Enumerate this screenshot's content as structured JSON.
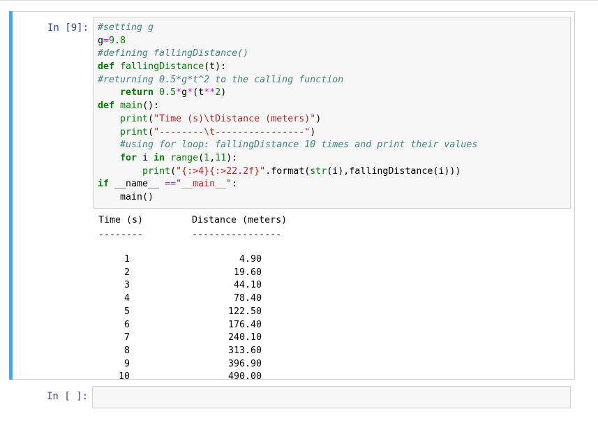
{
  "cells": [
    {
      "prompt": "In [9]:",
      "code_lines": [
        [
          {
            "c": "cm",
            "t": "#setting g"
          }
        ],
        [
          {
            "c": "",
            "t": "g"
          },
          {
            "c": "op",
            "t": "="
          },
          {
            "c": "num",
            "t": "9.8"
          }
        ],
        [
          {
            "c": "cm",
            "t": "#defining fallingDistance()"
          }
        ],
        [
          {
            "c": "kw",
            "t": "def"
          },
          {
            "c": "",
            "t": " "
          },
          {
            "c": "nm",
            "t": "fallingDistance"
          },
          {
            "c": "",
            "t": "(t):"
          }
        ],
        [
          {
            "c": "cm",
            "t": "#returning 0.5*g*t^2 to the calling function"
          }
        ],
        [
          {
            "c": "",
            "t": "    "
          },
          {
            "c": "kw",
            "t": "return"
          },
          {
            "c": "",
            "t": " "
          },
          {
            "c": "num",
            "t": "0.5"
          },
          {
            "c": "op",
            "t": "*"
          },
          {
            "c": "",
            "t": "g"
          },
          {
            "c": "op",
            "t": "*"
          },
          {
            "c": "",
            "t": "(t"
          },
          {
            "c": "op",
            "t": "**"
          },
          {
            "c": "num",
            "t": "2"
          },
          {
            "c": "",
            "t": ")"
          }
        ],
        [
          {
            "c": "kw",
            "t": "def"
          },
          {
            "c": "",
            "t": " "
          },
          {
            "c": "nm",
            "t": "main"
          },
          {
            "c": "",
            "t": "():"
          }
        ],
        [
          {
            "c": "",
            "t": "    "
          },
          {
            "c": "nm",
            "t": "print"
          },
          {
            "c": "",
            "t": "("
          },
          {
            "c": "st",
            "t": "\"Time (s)\\tDistance (meters)\""
          },
          {
            "c": "",
            "t": ")"
          }
        ],
        [
          {
            "c": "",
            "t": "    "
          },
          {
            "c": "nm",
            "t": "print"
          },
          {
            "c": "",
            "t": "("
          },
          {
            "c": "st",
            "t": "\"--------\\t----------------\""
          },
          {
            "c": "",
            "t": ")"
          }
        ],
        [
          {
            "c": "",
            "t": "    "
          },
          {
            "c": "cm",
            "t": "#using for loop: fallingDistance 10 times and print their values"
          }
        ],
        [
          {
            "c": "",
            "t": "    "
          },
          {
            "c": "kw",
            "t": "for"
          },
          {
            "c": "",
            "t": " i "
          },
          {
            "c": "kw",
            "t": "in"
          },
          {
            "c": "",
            "t": " "
          },
          {
            "c": "nm",
            "t": "range"
          },
          {
            "c": "",
            "t": "("
          },
          {
            "c": "num",
            "t": "1"
          },
          {
            "c": "",
            "t": ","
          },
          {
            "c": "num",
            "t": "11"
          },
          {
            "c": "",
            "t": "):"
          }
        ],
        [
          {
            "c": "",
            "t": "        "
          },
          {
            "c": "nm",
            "t": "print"
          },
          {
            "c": "",
            "t": "("
          },
          {
            "c": "st",
            "t": "\"{:>4}{:>22.2f}\""
          },
          {
            "c": "",
            "t": "."
          },
          {
            "c": "",
            "t": "format("
          },
          {
            "c": "nm",
            "t": "str"
          },
          {
            "c": "",
            "t": "(i),fallingDistance(i)))"
          }
        ],
        [
          {
            "c": "kw",
            "t": "if"
          },
          {
            "c": "",
            "t": " __name__ "
          },
          {
            "c": "op",
            "t": "=="
          },
          {
            "c": "st",
            "t": "\"__main__\""
          },
          {
            "c": "",
            "t": ":"
          }
        ],
        [
          {
            "c": "",
            "t": "    main()"
          }
        ]
      ],
      "output": {
        "header_time": "Time (s)",
        "header_distance": "Distance (meters)",
        "dash_time": "--------",
        "dash_distance": "----------------",
        "rows": [
          {
            "t": "1",
            "d": "4.90"
          },
          {
            "t": "2",
            "d": "19.60"
          },
          {
            "t": "3",
            "d": "44.10"
          },
          {
            "t": "4",
            "d": "78.40"
          },
          {
            "t": "5",
            "d": "122.50"
          },
          {
            "t": "6",
            "d": "176.40"
          },
          {
            "t": "7",
            "d": "240.10"
          },
          {
            "t": "8",
            "d": "313.60"
          },
          {
            "t": "9",
            "d": "396.90"
          },
          {
            "t": "10",
            "d": "490.00"
          }
        ]
      }
    },
    {
      "prompt": "In [ ]:"
    }
  ],
  "colors": {
    "selected_bar": "#42a5f5",
    "prompt": "#303f9f",
    "input_bg": "#f7f7f7"
  }
}
